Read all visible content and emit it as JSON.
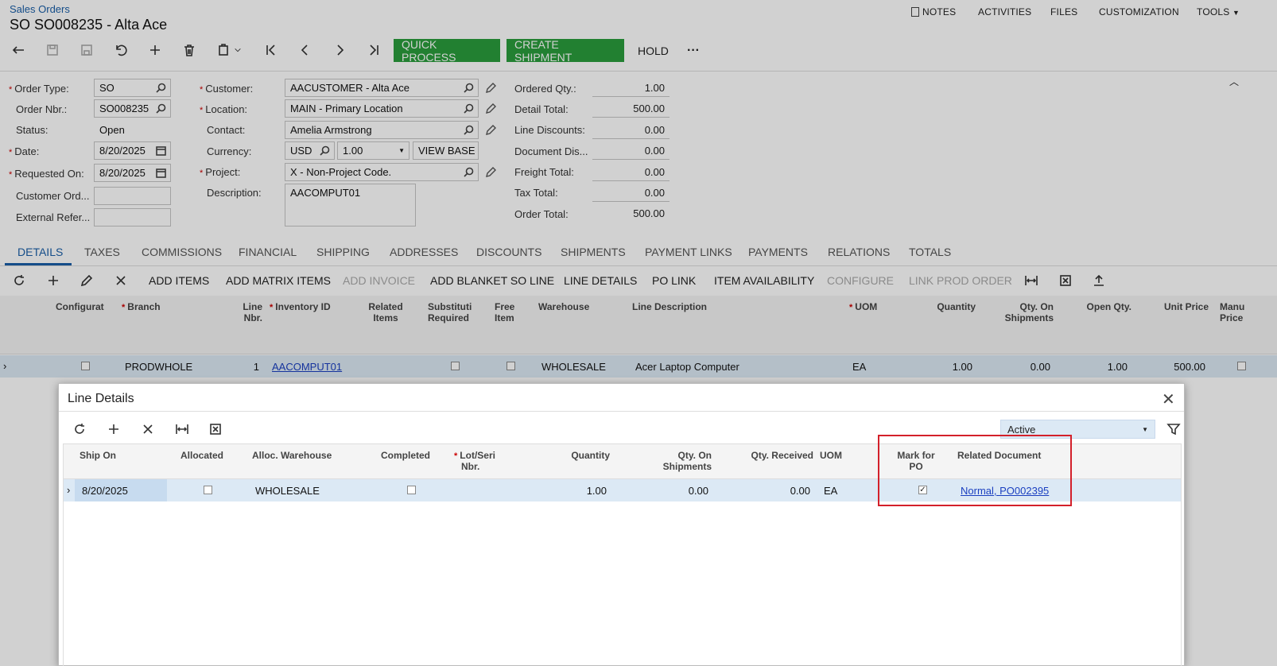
{
  "header": {
    "breadcrumb": "Sales Orders",
    "title": "SO SO008235 - Alta Ace",
    "menu": [
      "NOTES",
      "ACTIVITIES",
      "FILES",
      "CUSTOMIZATION",
      "TOOLS"
    ]
  },
  "toolbar": {
    "quick_process": "QUICK PROCESS",
    "create_shipment": "CREATE SHIPMENT",
    "hold": "HOLD",
    "more": "···",
    "accent": "#2a9d3c"
  },
  "form": {
    "order_type_label": "Order Type:",
    "order_type": "SO",
    "order_nbr_label": "Order Nbr.:",
    "order_nbr": "SO008235",
    "status_label": "Status:",
    "status": "Open",
    "date_label": "Date:",
    "date": "8/20/2025",
    "requested_on_label": "Requested On:",
    "requested_on": "8/20/2025",
    "customer_ord_label": "Customer Ord...",
    "external_ref_label": "External Refer...",
    "customer_label": "Customer:",
    "customer": "AACUSTOMER - Alta Ace",
    "location_label": "Location:",
    "location": "MAIN - Primary Location",
    "contact_label": "Contact:",
    "contact": "Amelia Armstrong",
    "currency_label": "Currency:",
    "currency": "USD",
    "rate": "1.00",
    "view_base": "VIEW BASE",
    "project_label": "Project:",
    "project": "X - Non-Project Code.",
    "description_label": "Description:",
    "description": "AACOMPUT01"
  },
  "totals": {
    "ordered_qty_label": "Ordered Qty.:",
    "ordered_qty": "1.00",
    "detail_total_label": "Detail Total:",
    "detail_total": "500.00",
    "line_discounts_label": "Line Discounts:",
    "line_discounts": "0.00",
    "document_dis_label": "Document Dis...",
    "document_dis": "0.00",
    "freight_total_label": "Freight Total:",
    "freight_total": "0.00",
    "tax_total_label": "Tax Total:",
    "tax_total": "0.00",
    "order_total_label": "Order Total:",
    "order_total": "500.00"
  },
  "tabs": [
    "DETAILS",
    "TAXES",
    "COMMISSIONS",
    "FINANCIAL",
    "SHIPPING",
    "ADDRESSES",
    "DISCOUNTS",
    "SHIPMENTS",
    "PAYMENT LINKS",
    "PAYMENTS",
    "RELATIONS",
    "TOTALS"
  ],
  "grid_toolbar": {
    "add_items": "ADD ITEMS",
    "add_matrix_items": "ADD MATRIX ITEMS",
    "add_invoice": "ADD INVOICE",
    "add_blanket": "ADD BLANKET SO LINE",
    "line_details": "LINE DETAILS",
    "po_link": "PO LINK",
    "item_availability": "ITEM AVAILABILITY",
    "configure": "CONFIGURE",
    "link_prod_order": "LINK PROD ORDER"
  },
  "grid": {
    "headers": {
      "configurat": "Configurat",
      "branch": "Branch",
      "line_nbr_1": "Line",
      "line_nbr_2": "Nbr.",
      "inventory_id": "Inventory ID",
      "related_1": "Related",
      "related_2": "Items",
      "substitution_1": "Substituti",
      "substitution_2": "Required",
      "free_1": "Free",
      "free_2": "Item",
      "warehouse": "Warehouse",
      "line_description": "Line Description",
      "uom": "UOM",
      "quantity": "Quantity",
      "qty_on_ship_1": "Qty. On",
      "qty_on_ship_2": "Shipments",
      "open_qty": "Open Qty.",
      "unit_price": "Unit Price",
      "manual_1": "Manu",
      "manual_2": "Price"
    },
    "row": {
      "branch": "PRODWHOLE",
      "line_nbr": "1",
      "inventory_id": "AACOMPUT01",
      "warehouse": "WHOLESALE",
      "line_description": "Acer Laptop Computer",
      "uom": "EA",
      "quantity": "1.00",
      "qty_on_shipments": "0.00",
      "open_qty": "1.00",
      "unit_price": "500.00"
    }
  },
  "dialog": {
    "title": "Line Details",
    "filter_value": "Active",
    "headers": {
      "ship_on": "Ship On",
      "allocated": "Allocated",
      "alloc_warehouse": "Alloc. Warehouse",
      "completed": "Completed",
      "lot_1": "Lot/Seri",
      "lot_2": "Nbr.",
      "quantity": "Quantity",
      "qty_on_ship_1": "Qty. On",
      "qty_on_ship_2": "Shipments",
      "qty_received": "Qty. Received",
      "uom": "UOM",
      "mark_po_1": "Mark for",
      "mark_po_2": "PO",
      "related_document": "Related Document"
    },
    "row": {
      "ship_on": "8/20/2025",
      "alloc_warehouse": "WHOLESALE",
      "quantity": "1.00",
      "qty_on_shipments": "0.00",
      "qty_received": "0.00",
      "uom": "EA",
      "mark_for_po": true,
      "related_document": "Normal, PO002395"
    },
    "highlight_color": "#d3202a"
  }
}
